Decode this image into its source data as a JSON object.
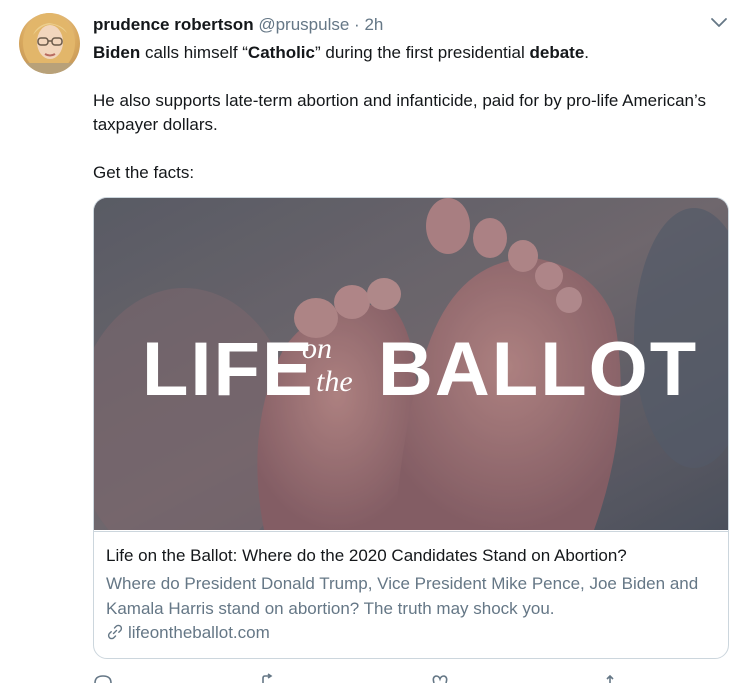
{
  "tweet": {
    "author_name": "prudence robertson",
    "handle": "@pruspulse",
    "separator": "·",
    "time": "2h",
    "text_line1": {
      "parts": [
        "Biden",
        " calls himself “",
        "Catholic",
        "” during the first presidential ",
        "debate",
        "."
      ]
    },
    "text_line2": "He also supports late-term abortion and infanticide, paid for by pro-life American’s taxpayer dollars.",
    "text_line3": "Get the facts:"
  },
  "card": {
    "image_logo_text": {
      "left": "LIFE",
      "small_top": "on",
      "small_bottom": "the",
      "right": "BALLOT"
    },
    "title": "Life on the Ballot: Where do the 2020 Candidates Stand on Abortion?",
    "description": "Where do President Donald Trump, Vice President Mike Pence, Joe Biden and Kamala Harris stand on abortion? The truth may shock you.",
    "domain": "lifeontheballot.com"
  },
  "icons": {
    "caret": "chevron-down-icon",
    "link": "link-icon",
    "reply": "reply-icon",
    "retweet": "retweet-icon",
    "like": "heart-icon",
    "share": "share-icon"
  },
  "colors": {
    "text": "#14171a",
    "muted": "#657786",
    "border": "#ccd6dd"
  }
}
